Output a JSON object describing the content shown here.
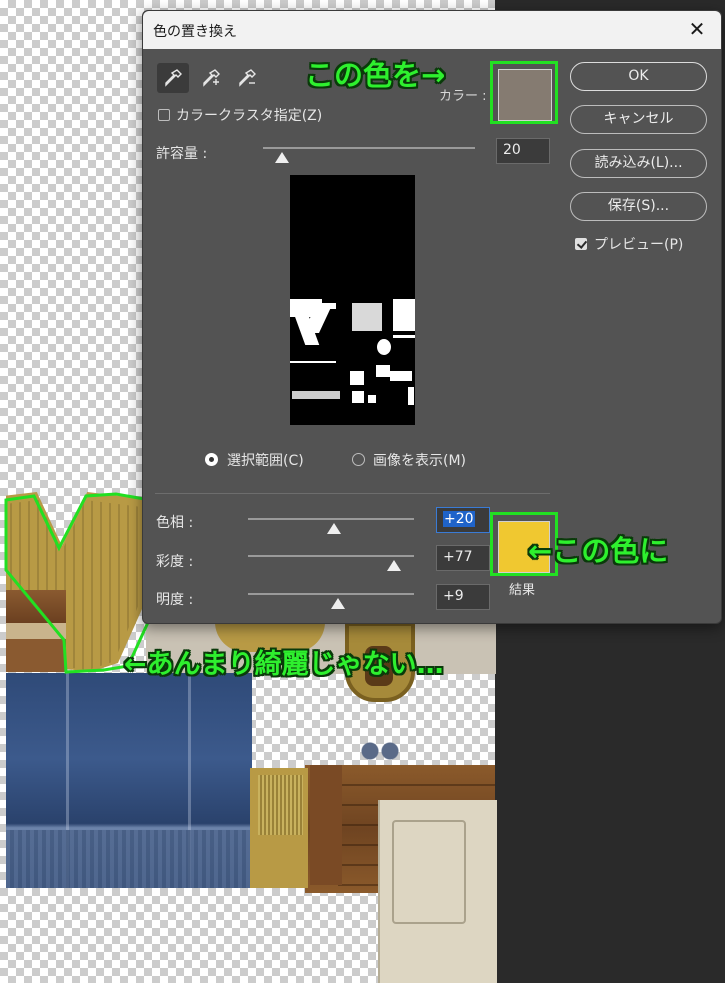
{
  "dialog": {
    "title": "色の置き換え",
    "close_glyph": "✕",
    "eyedroppers": [
      "eyedropper-icon",
      "eyedropper-plus-icon",
      "eyedropper-minus-icon"
    ],
    "color_cluster_label": "カラークラスタ指定(Z)",
    "color_cluster_checked": false,
    "color_label": "カラー :",
    "source_color": "#857b71",
    "tolerance_label": "許容量 :",
    "tolerance_value": "20",
    "tolerance_fraction": 0.09,
    "view_mode": {
      "selection_label": "選択範囲(C)",
      "image_label": "画像を表示(M)",
      "selected": "selection"
    },
    "replacement": {
      "hue_label": "色相 :",
      "hue_value": "+20",
      "hue_fraction": 0.52,
      "saturation_label": "彩度 :",
      "saturation_value": "+77",
      "saturation_fraction": 0.88,
      "lightness_label": "明度 :",
      "lightness_value": "+9",
      "lightness_fraction": 0.54,
      "result_label": "結果",
      "result_color": "#f0c830"
    },
    "buttons": {
      "ok": "OK",
      "cancel": "キャンセル",
      "load": "読み込み(L)...",
      "save": "保存(S)..."
    },
    "preview_label": "プレビュー(P)",
    "preview_checked": true
  },
  "annotations": {
    "source_note": "この色を→",
    "result_note": "←この色に",
    "canvas_note": "←あんまり綺麗じゃない…",
    "highlight_color": "#22e022"
  }
}
